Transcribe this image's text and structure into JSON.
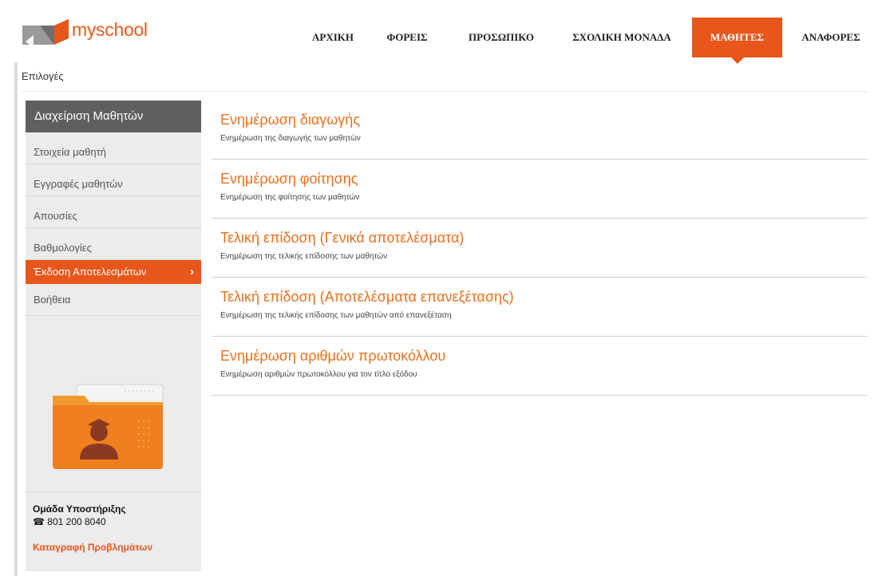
{
  "brand": {
    "name": "myschool",
    "accent": "#e8561b"
  },
  "nav": {
    "items": [
      {
        "label": "ΑΡΧΙΚΗ"
      },
      {
        "label": "ΦΟΡΕΙΣ"
      },
      {
        "label": "ΠΡΟΣΩΠΙΚΟ"
      },
      {
        "label": "ΣΧΟΛΙΚΗ ΜΟΝΑΔΑ"
      },
      {
        "label": "ΜΑΘΗΤΕΣ",
        "active": true
      },
      {
        "label": "ΑΝΑΦΟΡΕΣ"
      }
    ]
  },
  "breadcrumb": "Επιλογές",
  "sidebar": {
    "title": "Διαχείριση Μαθητών",
    "items": [
      {
        "label": "Στοιχεία μαθητή"
      },
      {
        "label": "Εγγραφές μαθητών"
      },
      {
        "label": "Απουσίες"
      },
      {
        "label": "Βαθμολογίες"
      },
      {
        "label": "Έκδοση Αποτελεσμάτων",
        "active": true,
        "icon": "chevron-right-icon"
      },
      {
        "label": "Βοήθεια"
      }
    ],
    "illustration": "student-folder-icon",
    "support": {
      "title": "Ομάδα Υποστήριξης",
      "phone_icon": "phone-icon",
      "phone": "801 200 8040",
      "link": "Καταγραφή Προβλημάτων"
    }
  },
  "entries": [
    {
      "title": "Ενημέρωση διαγωγής",
      "description": "Ενημέρωση της διαγωγής των μαθητών"
    },
    {
      "title": "Ενημέρωση φοίτησης",
      "description": "Ενημέρωση της φοίτησης των μαθητών"
    },
    {
      "title": "Τελική επίδοση (Γενικά αποτελέσματα)",
      "description": "Ενημέρωση της τελικής επίδοσης των μαθητών"
    },
    {
      "title": "Τελική επίδοση (Αποτελέσματα επανεξέτασης)",
      "description": "Ενημέρωση της τελικής επίδοσης των μαθητών από επανεξέταση"
    },
    {
      "title": "Ενημέρωση αριθμών πρωτοκόλλου",
      "description": "Ενημέρωση αριθμών πρωτοκόλλου για τον τίτλο εξόδου"
    }
  ]
}
